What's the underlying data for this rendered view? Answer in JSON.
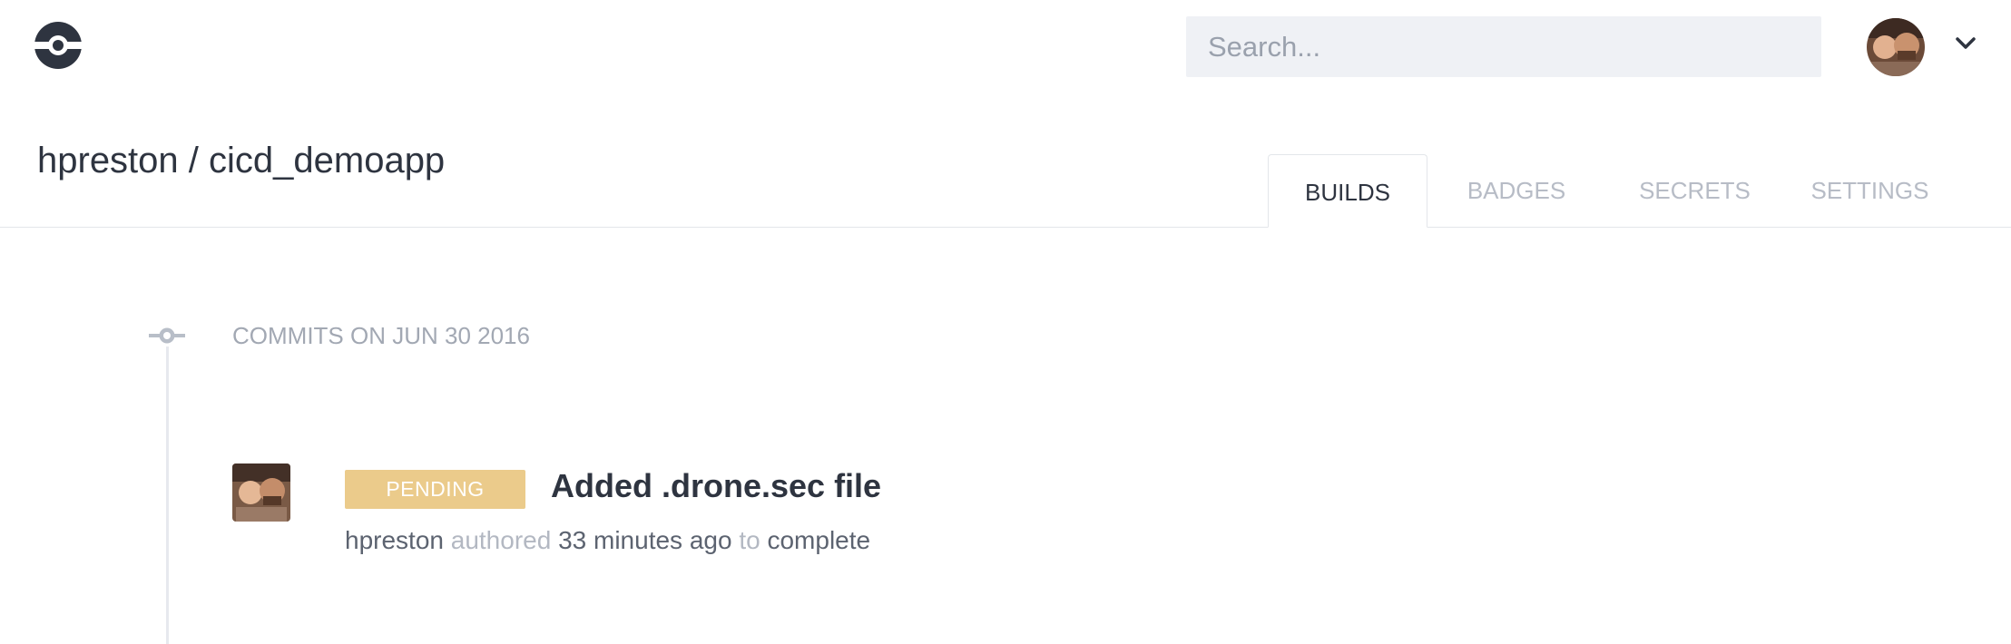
{
  "header": {
    "logo_icon": "drone-logo-icon",
    "search": {
      "placeholder": "Search...",
      "value": ""
    },
    "user_menu_icon": "chevron-down-icon"
  },
  "repo": {
    "title": "hpreston / cicd_demoapp"
  },
  "tabs": [
    {
      "label": "BUILDS",
      "active": true
    },
    {
      "label": "BADGES",
      "active": false
    },
    {
      "label": "SECRETS",
      "active": false
    },
    {
      "label": "SETTINGS",
      "active": false
    }
  ],
  "timeline": {
    "group_label": "COMMITS ON JUN 30 2016",
    "builds": [
      {
        "status": "PENDING",
        "title": "Added .drone.sec file",
        "author": "hpreston",
        "authored_word": "authored",
        "time_ago": "33 minutes ago",
        "to_word": "to",
        "branch": "complete"
      }
    ]
  },
  "colors": {
    "pending": "#ebcb8b",
    "text_dark": "#2e3440",
    "text_muted": "#a2a8b3",
    "search_bg": "#eff1f5",
    "divider": "#e3e6ea"
  }
}
